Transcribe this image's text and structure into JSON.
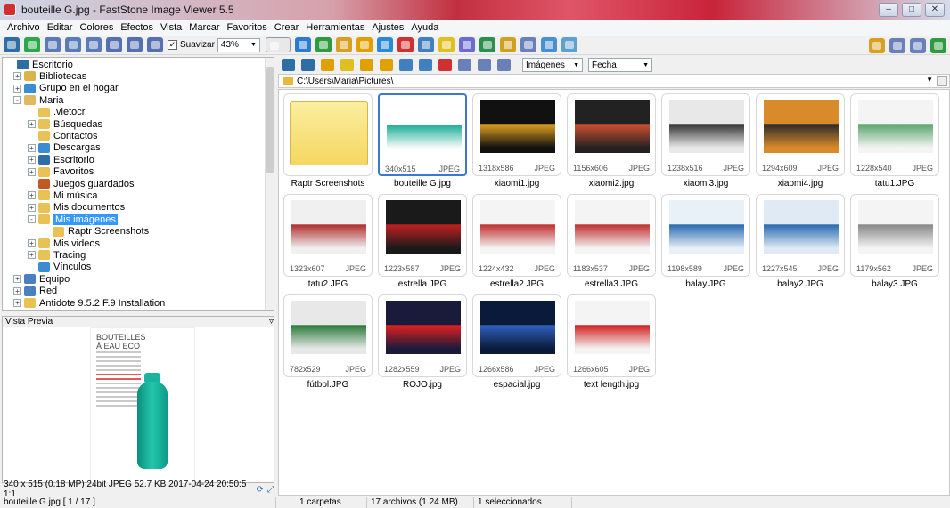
{
  "window": {
    "title": "bouteille G.jpg - FastStone Image Viewer 5.5",
    "title_accent": "#c8243a",
    "buttons": [
      "minimize",
      "maximize",
      "close"
    ]
  },
  "menu": [
    "Archivo",
    "Editar",
    "Colores",
    "Efectos",
    "Vista",
    "Marcar",
    "Favoritos",
    "Crear",
    "Herramientas",
    "Ajustes",
    "Ayuda"
  ],
  "toolbar": {
    "smooth_label": "Suavizar",
    "smooth_checked": true,
    "zoom_value": "43%",
    "icon_colors": [
      "#2f6ea5",
      "#2aa84a",
      "#5a7bb5",
      "#5a7bb5",
      "#5a7bb5",
      "#5470b0",
      "#5470b0",
      "#5470b0"
    ],
    "right_icon_colors": [
      "#2b7bd0",
      "#2e9b3e",
      "#d8a020",
      "#e0a000",
      "#2a8ad6",
      "#d03030",
      "#4080c0",
      "#e0c020",
      "#6b6bd0",
      "#2a9050",
      "#d0a020",
      "#6a80b8",
      "#4a90d0",
      "#60a0d0"
    ],
    "view_icons": [
      "thumbnail-view-icon",
      "preview-view-icon",
      "fullscreen-view-icon",
      "fit-icon"
    ]
  },
  "tree": {
    "rows": [
      {
        "label": "Escritorio",
        "icon": "#2f6ea5",
        "exp": ""
      },
      {
        "label": "Bibliotecas",
        "icon": "#d9b44a",
        "exp": "+"
      },
      {
        "label": "Grupo en el hogar",
        "icon": "#3a8dd0",
        "exp": "+"
      },
      {
        "label": "Maria",
        "icon": "#e0b860",
        "exp": "-"
      },
      {
        "label": ".vietocr",
        "icon": "#e9c255",
        "exp": ""
      },
      {
        "label": "Búsquedas",
        "icon": "#e9c255",
        "exp": "+"
      },
      {
        "label": "Contactos",
        "icon": "#e9c255",
        "exp": ""
      },
      {
        "label": "Descargas",
        "icon": "#3a8dd0",
        "exp": "+"
      },
      {
        "label": "Escritorio",
        "icon": "#2f6ea5",
        "exp": "+"
      },
      {
        "label": "Favoritos",
        "icon": "#e9c255",
        "exp": "+"
      },
      {
        "label": "Juegos guardados",
        "icon": "#c05a20",
        "exp": ""
      },
      {
        "label": "Mi música",
        "icon": "#e9c255",
        "exp": "+"
      },
      {
        "label": "Mis documentos",
        "icon": "#e9c255",
        "exp": "+"
      },
      {
        "label": "Mis imágenes",
        "icon": "#e9c255",
        "exp": "-",
        "selected": true
      },
      {
        "label": "Raptr Screenshots",
        "icon": "#e9c255",
        "exp": ""
      },
      {
        "label": "Mis videos",
        "icon": "#e9c255",
        "exp": "+"
      },
      {
        "label": "Tracing",
        "icon": "#e9c255",
        "exp": "+"
      },
      {
        "label": "Vínculos",
        "icon": "#3a8dd0",
        "exp": ""
      },
      {
        "label": "Equipo",
        "icon": "#4a7fc0",
        "exp": "+"
      },
      {
        "label": "Red",
        "icon": "#4a7fc0",
        "exp": "+"
      },
      {
        "label": "Antidote 9.5.2 F.9 Installation",
        "icon": "#e9c255",
        "exp": "+"
      }
    ]
  },
  "preview": {
    "header": "Vista Previa",
    "image_title": "BOUTEILLES À EAU ECO",
    "info": "340 x 515 (0.18 MP)  24bit  JPEG  52.7 KB  2017-04-24 20:50:5  1:1",
    "file_status": "bouteille G.jpg [ 1 / 17 ]"
  },
  "navbar": {
    "icon_colors": [
      "#2f6ea5",
      "#2f6ea5",
      "#e0a000",
      "#e0c020",
      "#e0a000",
      "#e0a000",
      "#4080c0",
      "#4080c0",
      "#d03030",
      "#6a80b8",
      "#6a80b8",
      "#6a80b8"
    ],
    "filter_label": "Imágenes",
    "sort_label": "Fecha"
  },
  "path": {
    "value": "C:\\Users\\Maria\\Pictures\\"
  },
  "status": {
    "folders": "1 carpetas",
    "files": "17 archivos (1.24 MB)",
    "selected": "1 seleccionados"
  },
  "thumbs": [
    {
      "name": "Raptr Screenshots",
      "folder": true
    },
    {
      "name": "bouteille G.jpg",
      "dims": "340x515",
      "fmt": "JPEG",
      "selected": true,
      "c1": "#ffffff",
      "c2": "#1fae98"
    },
    {
      "name": "xiaomi1.jpg",
      "dims": "1318x586",
      "fmt": "JPEG",
      "c1": "#111111",
      "c2": "#e0a020"
    },
    {
      "name": "xiaomi2.jpg",
      "dims": "1156x606",
      "fmt": "JPEG",
      "c1": "#222222",
      "c2": "#d05030"
    },
    {
      "name": "xiaomi3.jpg",
      "dims": "1238x516",
      "fmt": "JPEG",
      "c1": "#e8e8e8",
      "c2": "#333333"
    },
    {
      "name": "xiaomi4.jpg",
      "dims": "1294x609",
      "fmt": "JPEG",
      "c1": "#d98a2a",
      "c2": "#2a2a2a"
    },
    {
      "name": "tatu1.JPG",
      "dims": "1228x540",
      "fmt": "JPEG",
      "c1": "#f4f4f4",
      "c2": "#5aa56a"
    },
    {
      "name": "tatu2.JPG",
      "dims": "1323x607",
      "fmt": "JPEG",
      "c1": "#f0f0f0",
      "c2": "#b03030"
    },
    {
      "name": "estrella.JPG",
      "dims": "1223x587",
      "fmt": "JPEG",
      "c1": "#1a1a1a",
      "c2": "#c02020"
    },
    {
      "name": "estrella2.JPG",
      "dims": "1224x432",
      "fmt": "JPEG",
      "c1": "#f4f4f4",
      "c2": "#c03030"
    },
    {
      "name": "estrella3.JPG",
      "dims": "1183x537",
      "fmt": "JPEG",
      "c1": "#f4f4f4",
      "c2": "#c03030"
    },
    {
      "name": "balay.JPG",
      "dims": "1198x589",
      "fmt": "JPEG",
      "c1": "#e8f0f8",
      "c2": "#2a6ab0"
    },
    {
      "name": "balay2.JPG",
      "dims": "1227x545",
      "fmt": "JPEG",
      "c1": "#e0eaf4",
      "c2": "#2a6ab0"
    },
    {
      "name": "balay3.JPG",
      "dims": "1179x562",
      "fmt": "JPEG",
      "c1": "#f4f4f4",
      "c2": "#888888"
    },
    {
      "name": "fútbol.JPG",
      "dims": "782x529",
      "fmt": "JPEG",
      "c1": "#e8e8e8",
      "c2": "#2a7a3a"
    },
    {
      "name": "ROJO.jpg",
      "dims": "1282x559",
      "fmt": "JPEG",
      "c1": "#1a1a3a",
      "c2": "#e02020"
    },
    {
      "name": "espacial.jpg",
      "dims": "1266x586",
      "fmt": "JPEG",
      "c1": "#0a1a3a",
      "c2": "#3060c0"
    },
    {
      "name": "text length.jpg",
      "dims": "1266x605",
      "fmt": "JPEG",
      "c1": "#f4f4f4",
      "c2": "#d02020"
    }
  ]
}
